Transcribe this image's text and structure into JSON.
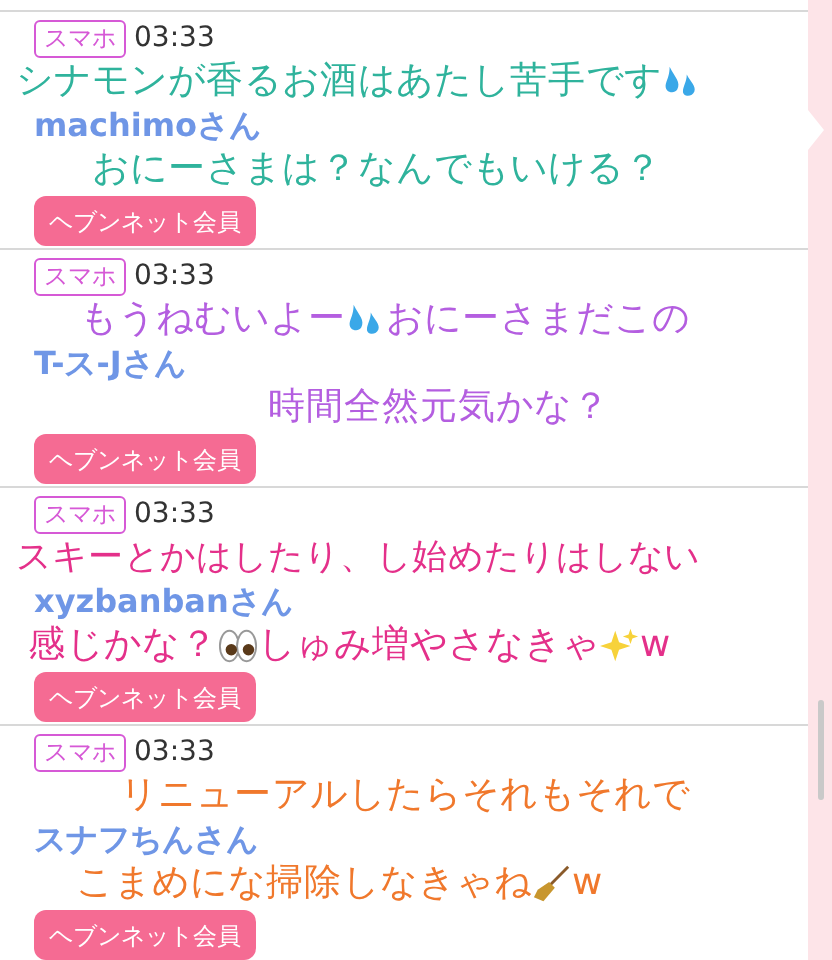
{
  "posts": [
    {
      "badge": "スマホ",
      "time": "03:33",
      "name": "machimoさん",
      "member_button": "ヘブンネット会員",
      "color": "#2fb39c",
      "lines": [
        [
          {
            "kind": "text",
            "text": "シナモンが香るお酒はあたし苦手です"
          },
          {
            "kind": "droplets"
          }
        ],
        [
          {
            "kind": "text",
            "text": "おにーさまは？なんでもいける？"
          }
        ]
      ]
    },
    {
      "badge": "スマホ",
      "time": "03:33",
      "name": "T-ス-Jさん",
      "member_button": "ヘブンネット会員",
      "color": "#b45ee0",
      "lines": [
        [
          {
            "kind": "text",
            "text": "もうねむいよー"
          },
          {
            "kind": "droplets"
          },
          {
            "kind": "text",
            "text": "おにーさまだこの"
          }
        ],
        [
          {
            "kind": "text",
            "text": "時間全然元気かな？"
          }
        ]
      ]
    },
    {
      "badge": "スマホ",
      "time": "03:33",
      "name": "xyzbanbanさん",
      "member_button": "ヘブンネット会員",
      "color": "#e4308a",
      "lines": [
        [
          {
            "kind": "text",
            "text": "スキーとかはしたり、し始めたりはしない"
          }
        ],
        [
          {
            "kind": "text",
            "text": "感じかな？"
          },
          {
            "kind": "eyes"
          },
          {
            "kind": "text",
            "text": "しゅみ増やさなきゃ"
          },
          {
            "kind": "sparkles"
          },
          {
            "kind": "text",
            "text": "w"
          }
        ]
      ]
    },
    {
      "badge": "スマホ",
      "time": "03:33",
      "name": "スナフちんさん",
      "member_button": "ヘブンネット会員",
      "color": "#f0782c",
      "lines": [
        [
          {
            "kind": "text",
            "text": "リニューアルしたらそれもそれで"
          }
        ],
        [
          {
            "kind": "text",
            "text": "こまめにな掃除しなきゃね"
          },
          {
            "kind": "broom"
          },
          {
            "kind": "text",
            "text": "w"
          }
        ]
      ]
    }
  ]
}
